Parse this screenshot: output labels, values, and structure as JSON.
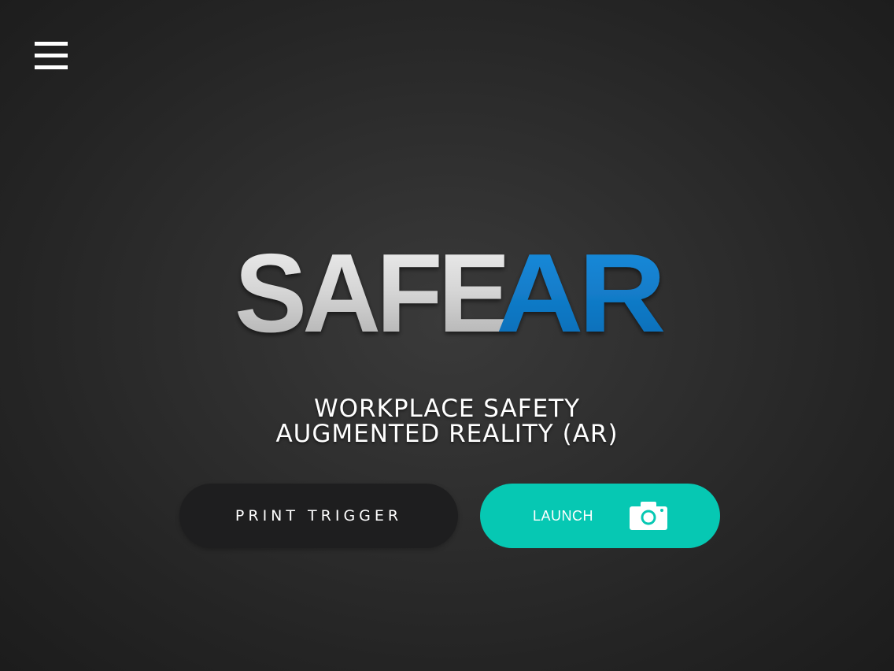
{
  "header": {
    "menu_icon": "hamburger-menu-icon"
  },
  "logo": {
    "part1": "SAFE",
    "part2": "AR",
    "colors": {
      "silver": "#d9d9d9",
      "blue": "#0c7fd0"
    }
  },
  "tagline": {
    "line1": "WORKPLACE SAFETY",
    "line2": "AUGMENTED REALITY (AR)"
  },
  "buttons": {
    "print_trigger": "PRINT TRIGGER",
    "launch": "LAUNCH",
    "launch_icon": "camera-icon"
  },
  "colors": {
    "background": "#2e2e2e",
    "accent": "#06c8b3",
    "print_button_bg": "#1e1e1f",
    "text": "#ffffff"
  }
}
